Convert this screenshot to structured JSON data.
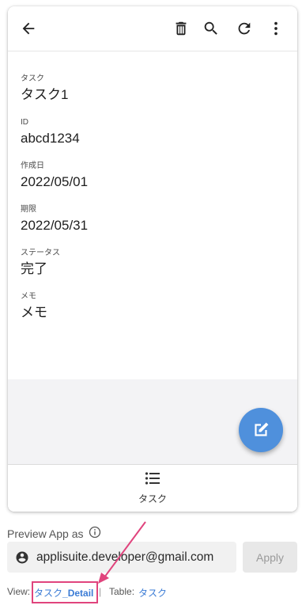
{
  "app": {
    "fields": [
      {
        "label": "タスク",
        "value": "タスク1"
      },
      {
        "label": "ID",
        "value": "abcd1234"
      },
      {
        "label": "作成日",
        "value": "2022/05/01"
      },
      {
        "label": "期限",
        "value": "2022/05/31"
      },
      {
        "label": "ステータス",
        "value": "完了"
      },
      {
        "label": "メモ",
        "value": "メモ"
      }
    ],
    "toolbar_icons": [
      "back-arrow-icon",
      "trash-icon",
      "search-icon",
      "refresh-icon",
      "more-vert-icon"
    ],
    "bottom_nav": {
      "label": "タスク",
      "icon": "list-icon"
    },
    "fab_icon": "edit-icon"
  },
  "preview": {
    "label": "Preview App as",
    "email": "applisuite.developer@gmail.com",
    "apply_label": "Apply"
  },
  "footer": {
    "view_label": "View:",
    "view_name_prefix": "タスク",
    "view_name_suffix": "_Detail",
    "separator": "|",
    "table_label": "Table:",
    "table_name": "タスク"
  },
  "colors": {
    "accent": "#4f90dc",
    "link": "#3a7bd5",
    "highlight": "#e0447d"
  }
}
